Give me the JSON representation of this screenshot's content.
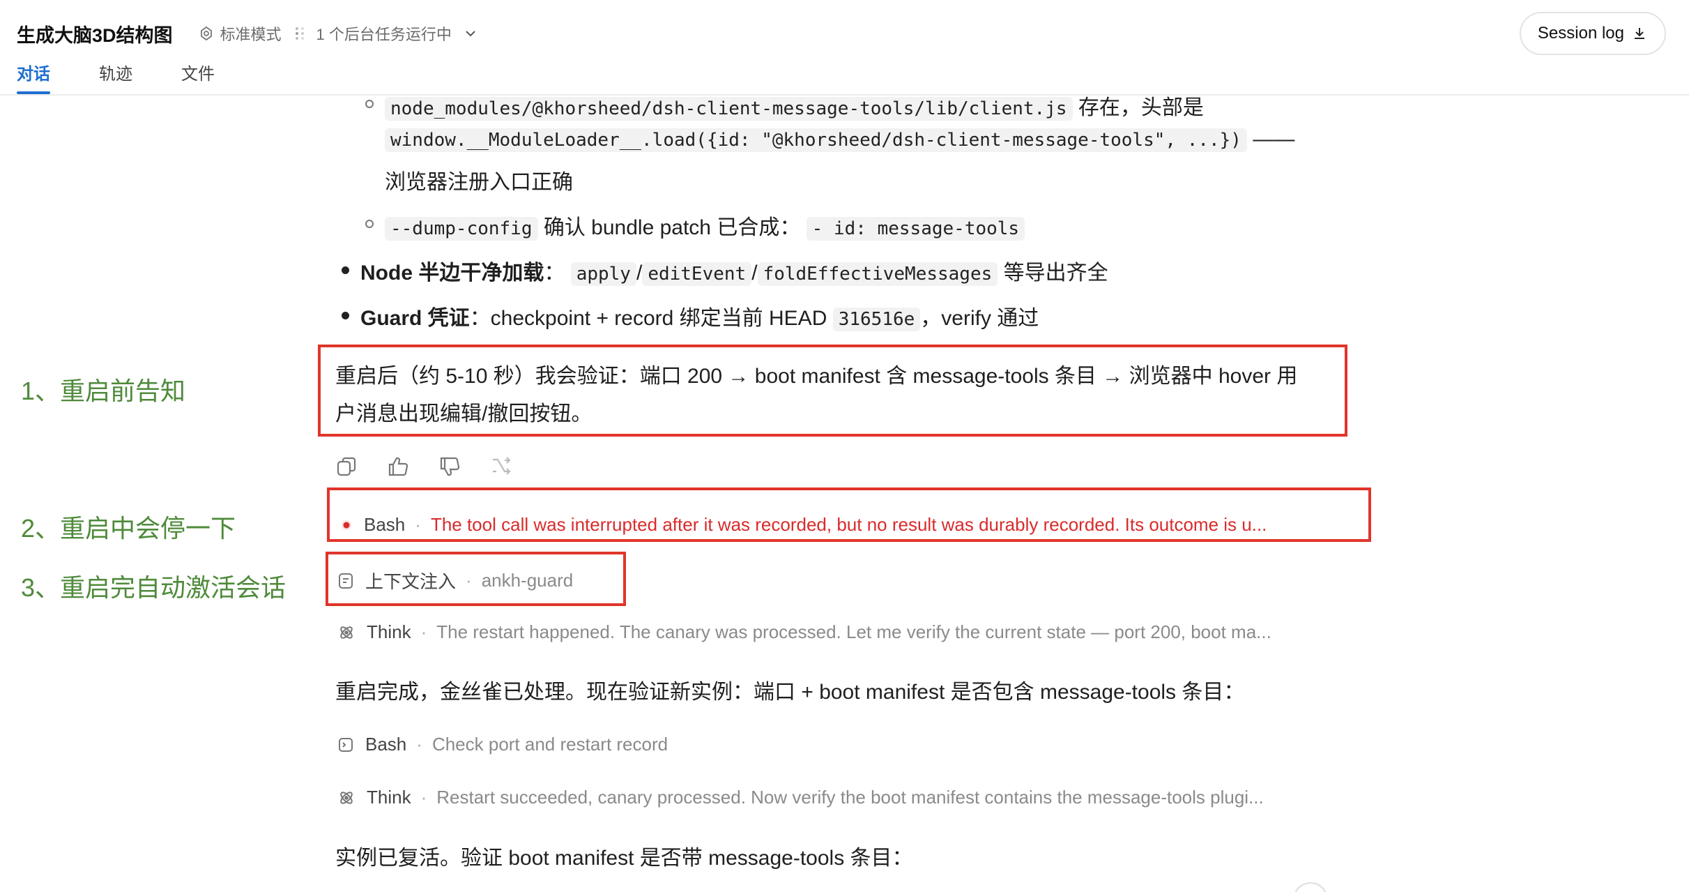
{
  "header": {
    "title": "生成大脑3D结构图",
    "mode_label": "标准模式",
    "background_tasks": "1 个后台任务运行中",
    "session_log_label": "Session log"
  },
  "tabs": [
    {
      "label": "对话",
      "active": true
    },
    {
      "label": "轨迹",
      "active": false
    },
    {
      "label": "文件",
      "active": false
    }
  ],
  "content": {
    "line1": {
      "code1": "node_modules/@khorsheed/dsh-client-message-tools/lib/client.js",
      "text1": "存在，头部是"
    },
    "line2": {
      "code": "window.__ModuleLoader__.load({id: \"@khorsheed/dsh-client-message-tools\", ...})",
      "dash": "——"
    },
    "line3": "浏览器注册入口正确",
    "line4": {
      "code1": "--dump-config",
      "text1": "确认 bundle patch 已合成：",
      "code2": "- id: message-tools"
    },
    "bullet_node": {
      "label": "Node 半边干净加载",
      "colon": "：",
      "code1": "apply",
      "slash1": "/",
      "code2": "editEvent",
      "slash2": "/",
      "code3": "foldEffectiveMessages",
      "text": "等导出齐全"
    },
    "bullet_guard": {
      "label": "Guard 凭证",
      "text1": "：checkpoint + record 绑定当前 HEAD",
      "code": "316516e",
      "text2": "，verify 通过"
    },
    "restart_notice_line1": "重启后（约 5-10 秒）我会验证：端口 200 → boot manifest 含 message-tools 条目 → 浏览器中 hover 用",
    "restart_notice_line2": "户消息出现编辑/撤回按钮。",
    "tool_bash_error": {
      "name": "Bash",
      "sep": "·",
      "text": "The tool call was interrupted after it was recorded, but no result was durably recorded. Its outcome is u..."
    },
    "context_inject": {
      "name": "上下文注入",
      "sep": "·",
      "text": "ankh-guard"
    },
    "think1": {
      "name": "Think",
      "sep": "·",
      "text": "The restart happened. The canary was processed. Let me verify the current state — port 200, boot ma..."
    },
    "para1": "重启完成，金丝雀已处理。现在验证新实例：端口 + boot manifest 是否包含 message-tools 条目：",
    "bash2": {
      "name": "Bash",
      "sep": "·",
      "text": "Check port and restart record"
    },
    "think2": {
      "name": "Think",
      "sep": "·",
      "text": "Restart succeeded, canary processed. Now verify the boot manifest contains the message-tools plugi..."
    },
    "para2": "实例已复活。验证 boot manifest 是否带 message-tools 条目："
  },
  "annotations": {
    "a1": "1、重启前告知",
    "a2": "2、重启中会停一下",
    "a3": "3、重启完自动激活会话"
  },
  "colors": {
    "accent": "#1f6fd1",
    "annotation_box": "#e0352b",
    "annotation_text": "#4e8a3a",
    "error_text": "#d92b2b"
  }
}
